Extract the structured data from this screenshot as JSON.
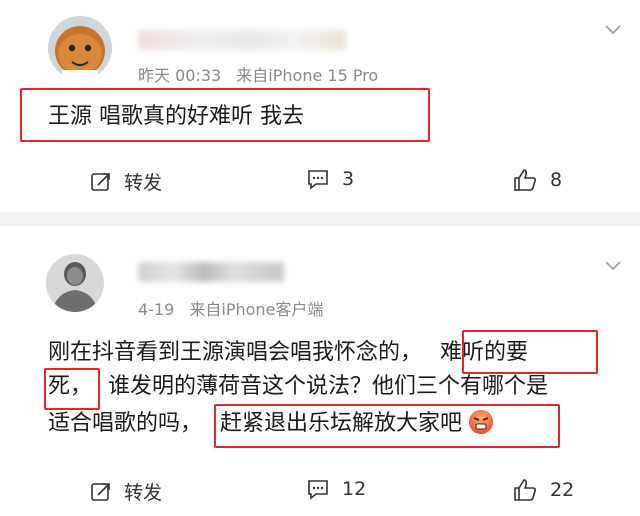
{
  "posts": [
    {
      "meta": {
        "time": "昨天 00:33",
        "source": "来自iPhone 15 Pro"
      },
      "content": "王源 唱歌真的好难听 我去",
      "actions": {
        "forward_label": "转发",
        "comment_count": "3",
        "like_count": "8"
      }
    },
    {
      "meta": {
        "time": "4-19",
        "source": "来自iPhone客户端"
      },
      "content_lines": [
        {
          "a": "刚在抖音看到王源演唱会唱我怀念的，",
          "b": "难听的要"
        },
        {
          "a": "死，",
          "b": "谁发明的薄荷音这个说法？他们三个有哪个是"
        },
        {
          "a": "适合唱歌的吗，",
          "b": "赶紧退出乐坛解放大家吧"
        }
      ],
      "actions": {
        "forward_label": "转发",
        "comment_count": "12",
        "like_count": "22"
      }
    }
  ],
  "icons": {
    "chevron": "chevron-down-icon",
    "forward": "forward-icon",
    "comment": "comment-icon",
    "like": "thumbs-up-icon",
    "emoji": "angry-face-emoji-icon"
  },
  "colors": {
    "highlight": "#e3262c",
    "meta": "#8a8a8a",
    "divider": "#f2f2f2"
  }
}
